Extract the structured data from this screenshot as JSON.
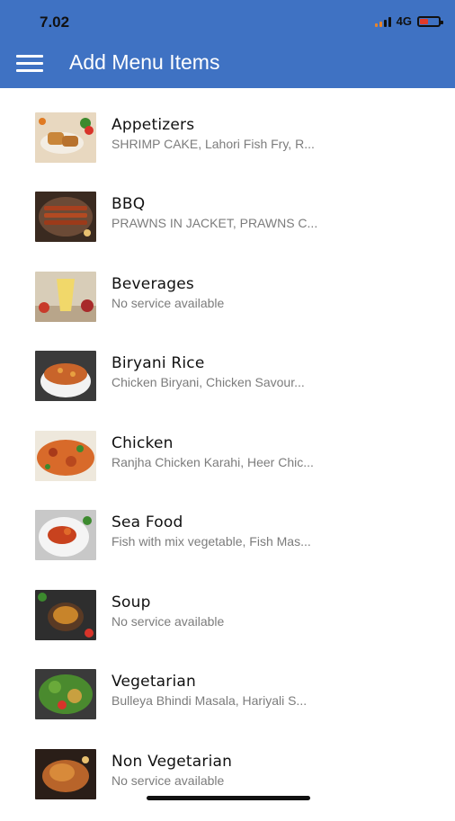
{
  "status_bar": {
    "time": "7.02",
    "network": "4G"
  },
  "header": {
    "title": "Add Menu Items",
    "menu_icon": "hamburger-menu-icon",
    "color": "#3f72c3"
  },
  "items": [
    {
      "name": "Appetizers",
      "desc": "SHRIMP CAKE,  Lahori Fish Fry, R...",
      "image": "appetizers-image"
    },
    {
      "name": "BBQ",
      "desc": "PRAWNS IN JACKET, PRAWNS C...",
      "image": "bbq-image"
    },
    {
      "name": "Beverages",
      "desc": "No service available",
      "image": "beverages-image"
    },
    {
      "name": "Biryani Rice",
      "desc": "Chicken Biryani, Chicken Savour...",
      "image": "biryani-image"
    },
    {
      "name": "Chicken",
      "desc": "Ranjha Chicken Karahi, Heer Chic...",
      "image": "chicken-image"
    },
    {
      "name": "Sea Food",
      "desc": "Fish with mix vegetable, Fish Mas...",
      "image": "seafood-image"
    },
    {
      "name": "Soup",
      "desc": "No service available",
      "image": "soup-image"
    },
    {
      "name": "Vegetarian",
      "desc": "Bulleya Bhindi Masala, Hariyali S...",
      "image": "vegetarian-image"
    },
    {
      "name": "Non Vegetarian",
      "desc": "No service available",
      "image": "non-vegetarian-image"
    }
  ]
}
